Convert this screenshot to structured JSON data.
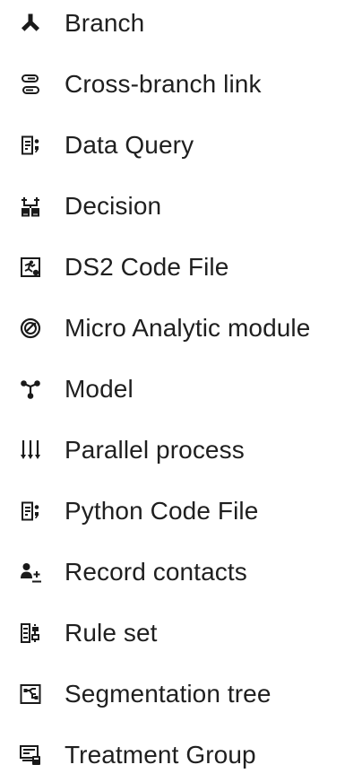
{
  "menu": {
    "items": [
      {
        "label": "Branch",
        "icon": "branch-icon"
      },
      {
        "label": "Cross-branch link",
        "icon": "cross-branch-link-icon"
      },
      {
        "label": "Data Query",
        "icon": "data-query-icon"
      },
      {
        "label": "Decision",
        "icon": "decision-icon"
      },
      {
        "label": "DS2 Code File",
        "icon": "ds2-code-file-icon"
      },
      {
        "label": "Micro Analytic module",
        "icon": "micro-analytic-module-icon"
      },
      {
        "label": "Model",
        "icon": "model-icon"
      },
      {
        "label": "Parallel process",
        "icon": "parallel-process-icon"
      },
      {
        "label": "Python Code File",
        "icon": "python-code-file-icon"
      },
      {
        "label": "Record contacts",
        "icon": "record-contacts-icon"
      },
      {
        "label": "Rule set",
        "icon": "rule-set-icon"
      },
      {
        "label": "Segmentation tree",
        "icon": "segmentation-tree-icon"
      },
      {
        "label": "Treatment Group",
        "icon": "treatment-group-icon"
      }
    ]
  },
  "colors": {
    "text": "#1f1f1f",
    "icon": "#1a1a1a",
    "background": "#ffffff"
  }
}
